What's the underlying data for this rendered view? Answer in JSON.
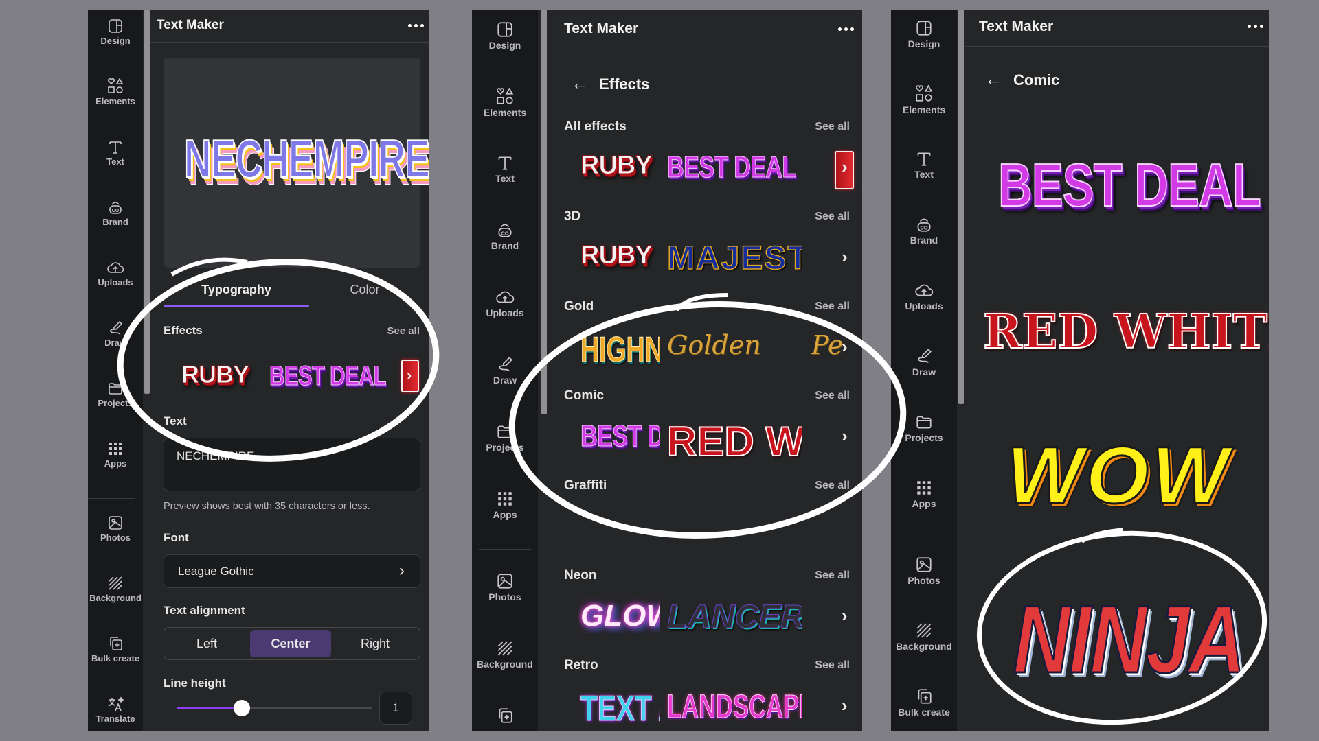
{
  "sidebar_labels": {
    "design": "Design",
    "elements": "Elements",
    "text": "Text",
    "brand": "Brand",
    "uploads": "Uploads",
    "draw": "Draw",
    "projects": "Projects",
    "apps": "Apps",
    "photos": "Photos",
    "background": "Background",
    "bulk_create": "Bulk create",
    "translate": "Translate"
  },
  "app_title": "Text Maker",
  "panel1": {
    "preview_text": "NECHEMPIRE",
    "tabs": [
      {
        "label": "Typography",
        "active": true
      },
      {
        "label": "Color",
        "active": false
      }
    ],
    "effects_label": "Effects",
    "see_all": "See all",
    "effects": [
      "RUBY",
      "BEST DEAL"
    ],
    "text_label": "Text",
    "text_value": "NECHEMPIRE",
    "hint": "Preview shows best with 35 characters or less.",
    "font_label": "Font",
    "font_value": "League Gothic",
    "alignment_label": "Text alignment",
    "alignment_options": [
      "Left",
      "Center",
      "Right"
    ],
    "alignment_selected": "Center",
    "line_height_label": "Line height",
    "line_height_value": "1",
    "line_height_slider_fraction": 0.33
  },
  "panel2": {
    "back_title": "Effects",
    "sections": [
      {
        "label": "All effects",
        "see_all": "See all",
        "samples": [
          "RUBY",
          "BEST DEAL"
        ]
      },
      {
        "label": "3D",
        "see_all": "See all",
        "samples": [
          "RUBY",
          "MAJESTI"
        ]
      },
      {
        "label": "Gold",
        "see_all": "See all",
        "samples": [
          "HIGHNESS",
          "Golden",
          "Pe"
        ]
      },
      {
        "label": "Comic",
        "see_all": "See all",
        "samples": [
          "BEST DEAL",
          "RED W"
        ]
      },
      {
        "label": "Graffiti",
        "see_all": "See all",
        "samples": []
      },
      {
        "label": "Neon",
        "see_all": "See all",
        "samples": [
          "GLOW",
          "LANCER"
        ]
      },
      {
        "label": "Retro",
        "see_all": "See all",
        "samples": [
          "TEXT ART",
          "LANDSCAPE"
        ]
      }
    ]
  },
  "panel3": {
    "back_title": "Comic",
    "samples": [
      "BEST DEAL",
      "RED WHITE",
      "WOW",
      "NINJA"
    ]
  },
  "colors": {
    "accent": "#8b5cf6",
    "panel_bg": "#252628",
    "sidebar_bg": "#18191b",
    "page_bg": "#807f86",
    "selected_segment": "#4b3a72"
  }
}
